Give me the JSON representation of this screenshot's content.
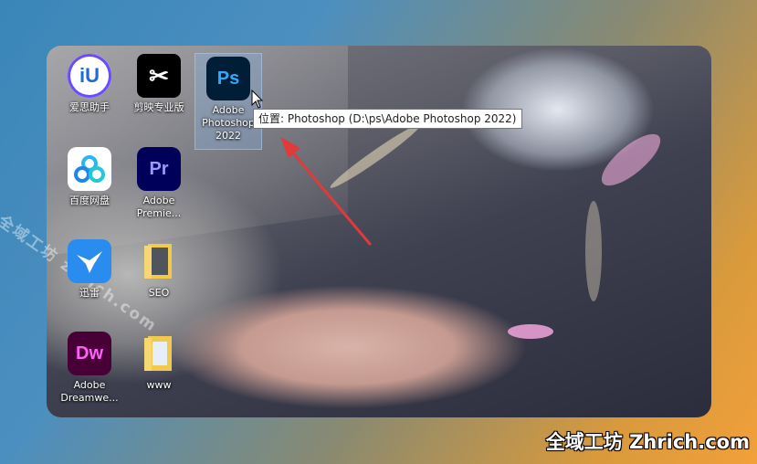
{
  "desktop": {
    "icons": [
      {
        "name": "aisi-icon",
        "label": "爱思助手",
        "glyph": "iU"
      },
      {
        "name": "jianying-icon",
        "label": "剪映专业版",
        "glyph": "✂"
      },
      {
        "name": "photoshop-icon",
        "label": "Adobe Photoshop 2022",
        "glyph": "Ps"
      },
      {
        "name": "baidu-netdisk-icon",
        "label": "百度网盘",
        "glyph": ""
      },
      {
        "name": "premiere-icon",
        "label": "Adobe Premie...",
        "glyph": "Pr"
      },
      {
        "name": "xunlei-icon",
        "label": "迅雷",
        "glyph": ""
      },
      {
        "name": "seo-folder-icon",
        "label": "SEO",
        "glyph": ""
      },
      {
        "name": "dreamweaver-icon",
        "label": "Adobe Dreamwe...",
        "glyph": "Dw"
      },
      {
        "name": "www-folder-icon",
        "label": "www",
        "glyph": ""
      }
    ],
    "tooltip": "位置: Photoshop (D:\\ps\\Adobe Photoshop 2022)"
  },
  "watermarks": {
    "diagonal": "全域工坊 zhrich.com",
    "corner": "全域工坊 Zhrich.com"
  },
  "colors": {
    "arrow": "#e03a3a",
    "photoshop": "#31a8ff",
    "premiere": "#9999ff",
    "dreamweaver": "#ff61f6"
  }
}
